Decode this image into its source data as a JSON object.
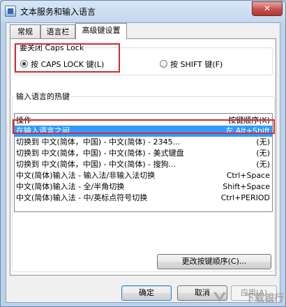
{
  "window": {
    "title": "文本服务和输入语言",
    "close_glyph": "✕"
  },
  "tabs": [
    {
      "label": "常规",
      "active": false
    },
    {
      "label": "语言栏",
      "active": false
    },
    {
      "label": "高级键设置",
      "active": true
    }
  ],
  "caps_lock": {
    "group_label": "要关闭 Caps Lock",
    "options": [
      {
        "label": "按 CAPS LOCK 键(L)",
        "selected": true
      },
      {
        "label": "按 SHIFT 键(F)",
        "selected": false
      }
    ]
  },
  "hotkeys": {
    "group_label": "输入语言的热键",
    "col_action": "操作",
    "col_sequence": "按键顺序(K)",
    "rows": [
      {
        "action": "在输入语言之间",
        "keys": "左 Alt+Shift",
        "selected": true
      },
      {
        "action": "切换到 中文(简体，中国) - 中文(简体) - 2345...",
        "keys": "(无)",
        "selected": false
      },
      {
        "action": "切换到 中文(简体，中国) - 中文(简体) - 美式键盘",
        "keys": "(无)",
        "selected": false
      },
      {
        "action": "切换到 中文(简体，中国) - 中文(简体) - 搜狗...",
        "keys": "(无)",
        "selected": false
      },
      {
        "action": "中文(简体)输入法 - 输入法/非输入法切换",
        "keys": "Ctrl+Space",
        "selected": false
      },
      {
        "action": "中文(简体)输入法 - 全/半角切换",
        "keys": "Shift+Space",
        "selected": false
      },
      {
        "action": "中文(简体)输入法 - 中/英标点符号切换",
        "keys": "Ctrl+PERIOD",
        "selected": false
      }
    ],
    "change_button": "更改按键顺序(C)..."
  },
  "footer": {
    "ok": "确定",
    "cancel": "取消",
    "apply": "应用(A)"
  },
  "watermark": {
    "text": "下载银行"
  },
  "colors": {
    "highlight": "#3399ff",
    "annotation_red": "#d9282f"
  }
}
